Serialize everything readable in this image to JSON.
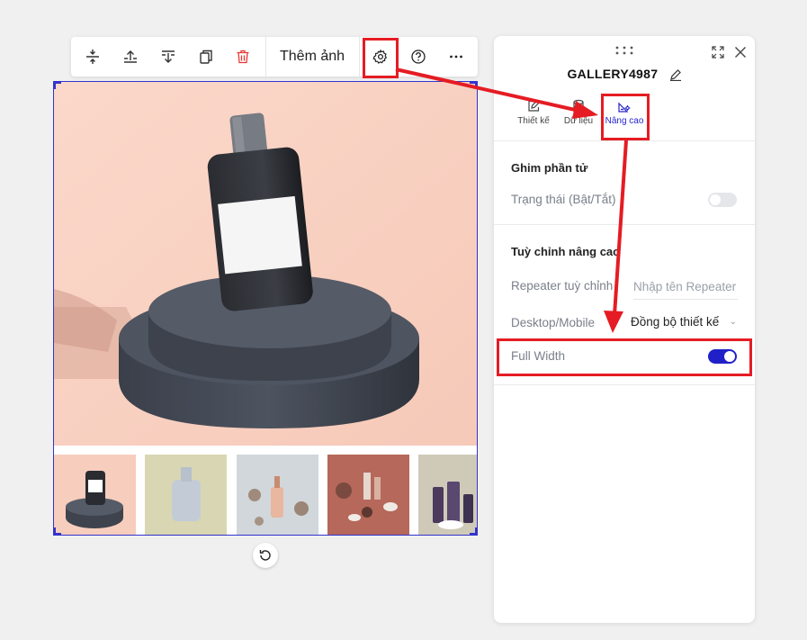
{
  "toolbar": {
    "buttons": [
      {
        "name": "move-inside-icon"
      },
      {
        "name": "align-top-icon"
      },
      {
        "name": "align-bottom-icon"
      },
      {
        "name": "duplicate-icon"
      },
      {
        "name": "delete-icon"
      }
    ],
    "add_image_label": "Thêm ảnh",
    "settings_icon": "gear-icon",
    "help_icon": "help-icon",
    "more_icon": "more-icon"
  },
  "gallery": {
    "main_image": "perfume-bottle-on-pedestal",
    "thumbnails": [
      {
        "name": "thumb-dark-bottle"
      },
      {
        "name": "thumb-white-bottle"
      },
      {
        "name": "thumb-dropper-bottle"
      },
      {
        "name": "thumb-cosmetics-flatlay"
      },
      {
        "name": "thumb-purple-bottles"
      }
    ]
  },
  "panel": {
    "title": "GALLERY4987",
    "tabs": [
      {
        "label": "Thiết kế",
        "icon": "edit-icon"
      },
      {
        "label": "Dữ liệu",
        "icon": "database-icon"
      },
      {
        "label": "Nâng cao",
        "icon": "advanced-icon",
        "active": true
      }
    ],
    "pin_section": {
      "title": "Ghim phần tử",
      "status_label": "Trạng thái (Bật/Tắt)",
      "status_on": false
    },
    "advanced_section": {
      "title": "Tuỳ chỉnh nâng cao",
      "repeater_label": "Repeater tuỳ chỉnh",
      "repeater_placeholder": "Nhập tên Repeater",
      "device_label": "Desktop/Mobile",
      "device_value": "Đồng bộ thiết kế",
      "full_width_label": "Full Width",
      "full_width_on": true
    }
  },
  "colors": {
    "highlight": "#e51c23",
    "accent": "#2020c8",
    "toggle_off": "#e4e6ea"
  }
}
